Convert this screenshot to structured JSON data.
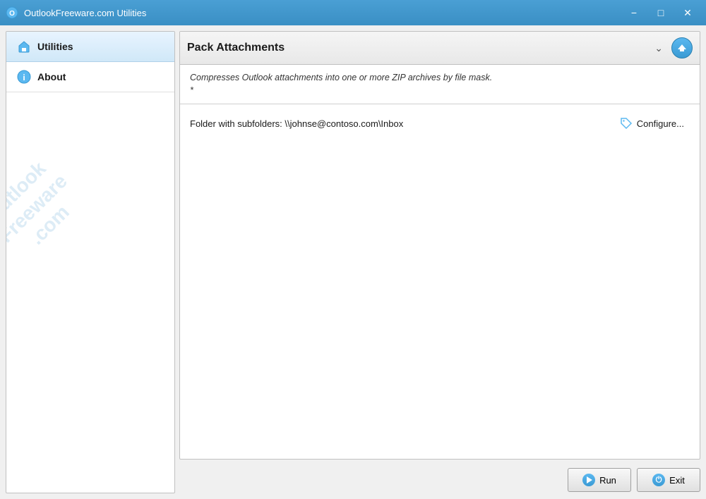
{
  "titlebar": {
    "title": "OutlookFreeware.com Utilities",
    "minimize_label": "−",
    "maximize_label": "□",
    "close_label": "✕"
  },
  "sidebar": {
    "watermark": "Outlook Freeware .com",
    "items": [
      {
        "id": "utilities",
        "label": "Utilities",
        "icon": "home",
        "active": true
      },
      {
        "id": "about",
        "label": "About",
        "icon": "info",
        "active": false
      }
    ]
  },
  "panel": {
    "title": "Pack Attachments",
    "description": "Compresses Outlook attachments into one or more ZIP archives by file mask.",
    "description_wildcard": "*",
    "folder_label": "Folder with subfolders: \\\\johnse@contoso.com\\Inbox",
    "configure_label": "Configure..."
  },
  "buttons": {
    "run_label": "Run",
    "exit_label": "Exit"
  }
}
